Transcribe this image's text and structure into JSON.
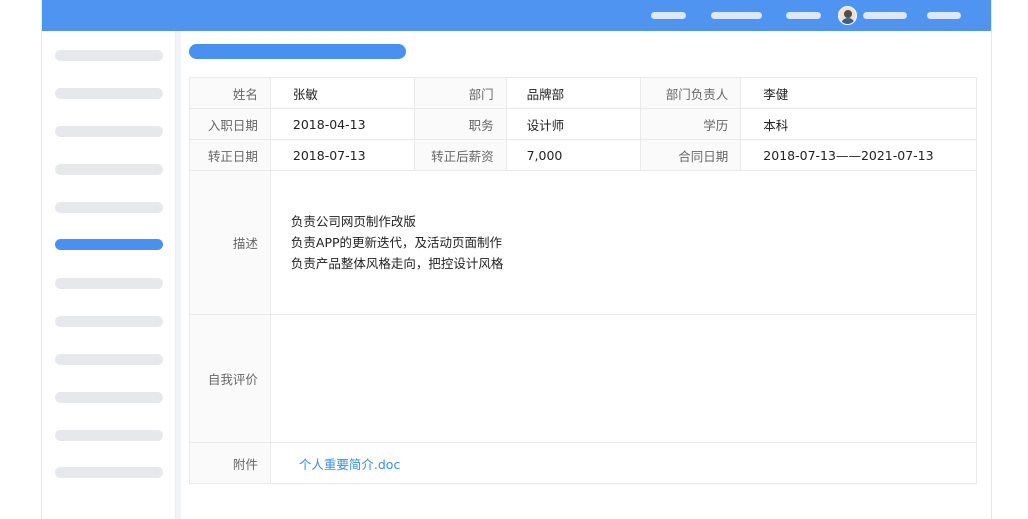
{
  "colors": {
    "topbar": "#4f94f0",
    "accent": "#4a90ee",
    "link": "#3a8ee6"
  },
  "icons": {
    "avatar": "user-avatar-photo"
  },
  "profile": {
    "name_label": "姓名",
    "name": "张敏",
    "dept_label": "部门",
    "dept": "品牌部",
    "head_label": "部门负责人",
    "head": "李健",
    "join_label": "入职日期",
    "join": "2018-04-13",
    "position_label": "职务",
    "position": "设计师",
    "edu_label": "学历",
    "edu": "本科",
    "regular_label": "转正日期",
    "regular": "2018-07-13",
    "salary_label": "转正后薪资",
    "salary": "7,000",
    "contract_label": "合同日期",
    "contract": "2018-07-13——2021-07-13",
    "desc_label": "描述",
    "desc_lines": [
      "负责公司网页制作改版",
      "负责APP的更新迭代，及活动页面制作",
      "负责产品整体风格走向，把控设计风格"
    ],
    "self_eval_label": "自我评价",
    "self_eval": "",
    "attach_label": "附件",
    "attach": "个人重要简介.doc"
  }
}
